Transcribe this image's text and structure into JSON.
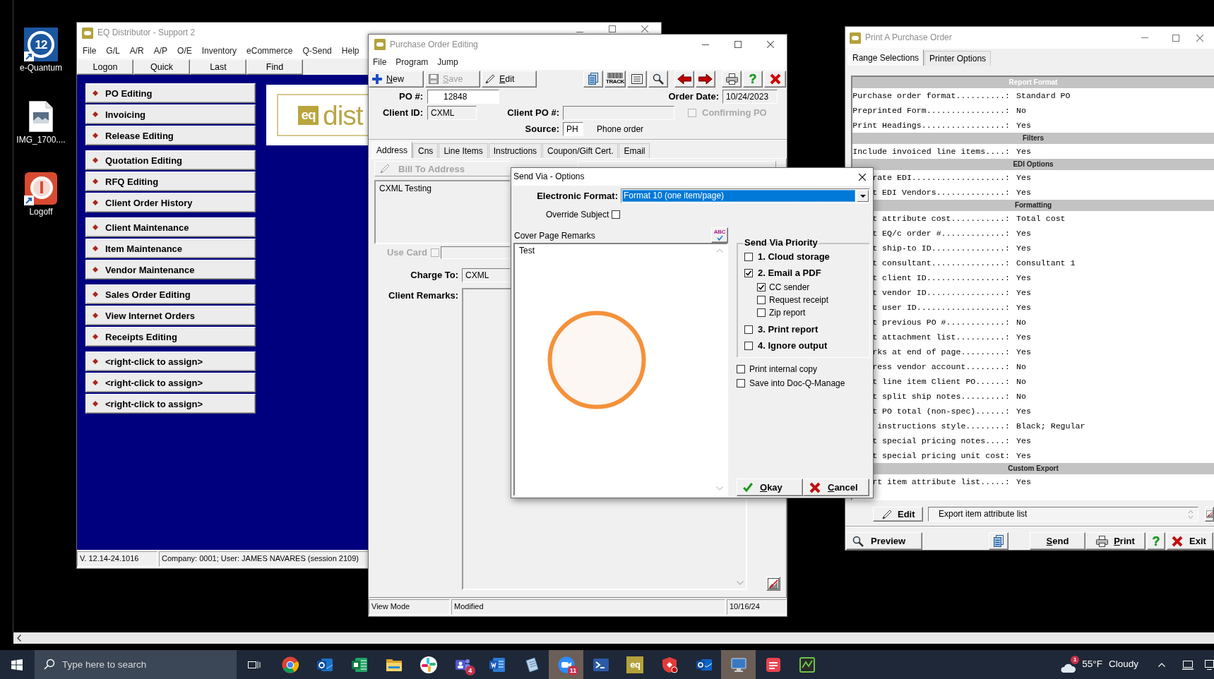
{
  "desktop_icons": [
    {
      "kind": "app",
      "label": "e-Quantum",
      "logo_text": "12"
    },
    {
      "kind": "image",
      "label": "IMG_1700...."
    },
    {
      "kind": "power",
      "label": "Logoff"
    }
  ],
  "eq_window": {
    "title": "EQ Distributor - Support 2",
    "menu": [
      "File",
      "G/L",
      "A/R",
      "A/P",
      "O/E",
      "Inventory",
      "eCommerce",
      "Q-Send",
      "Help"
    ],
    "toolbar": [
      "Logon",
      "Quick",
      "Last",
      "Find"
    ],
    "shortcut_groups": [
      {
        "items": [
          "PO Editing",
          "Invoicing",
          "Release Editing"
        ]
      },
      {
        "items": [
          "Quotation Editing",
          "RFQ Editing",
          "Client Order History"
        ]
      },
      {
        "items": [
          "Client Maintenance",
          "Item Maintenance",
          "Vendor Maintenance"
        ]
      },
      {
        "items": [
          "Sales Order Editing",
          "View Internet Orders",
          "Receipts Editing"
        ]
      },
      {
        "items": [
          "<right-click to assign>",
          "<right-click to assign>",
          "<right-click to assign>"
        ]
      }
    ],
    "logo": {
      "mark": "eq",
      "text": "dist"
    },
    "status_bar": [
      "V. 12.14-24.1016",
      "Company: 0001; User: JAMES NAVARES (session 2109)"
    ]
  },
  "po_window": {
    "title": "Purchase Order Editing",
    "menu": [
      "File",
      "Program",
      "Jump"
    ],
    "toolbar": [
      {
        "kind": "new",
        "label": "New",
        "disabled": false
      },
      {
        "kind": "save",
        "label": "Save",
        "disabled": true
      },
      {
        "kind": "edit",
        "label": "Edit",
        "disabled": false
      }
    ],
    "tool_buttons": [
      {
        "kind": "copy"
      },
      {
        "kind": "track",
        "text": "TRACK"
      },
      {
        "kind": "list"
      },
      {
        "kind": "find"
      },
      {
        "kind": "back"
      },
      {
        "kind": "forward"
      },
      {
        "kind": "print"
      },
      {
        "kind": "help",
        "text": "?"
      },
      {
        "kind": "close"
      }
    ],
    "po_number": {
      "label": "PO #:",
      "value": "12848"
    },
    "order_date": {
      "label": "Order Date:",
      "value": "10/24/2023"
    },
    "client_id": {
      "label": "Client ID:",
      "value": "CXML"
    },
    "client_po": {
      "label": "Client PO #:"
    },
    "confirming_po": {
      "label": "Confirming PO",
      "checked": false,
      "disabled": true
    },
    "source": {
      "label": "Source:",
      "value": "PH",
      "description": "Phone order"
    },
    "tabs": [
      {
        "label": "Address",
        "selected": true
      },
      {
        "label": "Cns",
        "selected": false
      },
      {
        "label": "Line Items",
        "selected": false
      },
      {
        "label": "Instructions",
        "selected": false
      },
      {
        "label": "Coupon/Gift Cert.",
        "selected": false
      },
      {
        "label": "Email",
        "selected": false
      }
    ],
    "bill_to": {
      "title": "Bill To Address",
      "disabled": true,
      "text": "CXML Testing"
    },
    "use_card": {
      "label": "Use Card",
      "checked": false,
      "disabled": true
    },
    "charge_to": {
      "label": "Charge To:",
      "value": "CXML"
    },
    "client_remarks": {
      "label": "Client Remarks:"
    },
    "status_bar": [
      "View Mode",
      "Modified",
      "10/16/24"
    ]
  },
  "send_via_dialog": {
    "title": "Send Via - Options",
    "electronic_format": {
      "label": "Electronic Format:",
      "value": "Format 10 (one item/page)"
    },
    "override_subject": {
      "label": "Override Subject",
      "checked": false
    },
    "cover_page_remarks": {
      "label": "Cover Page Remarks",
      "spell_check": "ABC",
      "value": "Test"
    },
    "priority": {
      "title": "Send Via Priority",
      "options": [
        {
          "label": "1. Cloud storage",
          "checked": false
        },
        {
          "label": "2. Email a PDF",
          "checked": true,
          "children": [
            {
              "label": "CC sender",
              "checked": true
            },
            {
              "label": "Request receipt",
              "checked": false
            },
            {
              "label": "Zip report",
              "checked": false
            }
          ]
        },
        {
          "label": "3. Print report",
          "checked": false
        },
        {
          "label": "4. Ignore output",
          "checked": false
        }
      ]
    },
    "extra_options": [
      {
        "label": "Print internal copy",
        "checked": false
      },
      {
        "label": "Save into Doc-Q-Manage",
        "checked": false
      }
    ],
    "buttons": [
      {
        "kind": "ok",
        "label": "Okay"
      },
      {
        "kind": "cancel",
        "label": "Cancel"
      }
    ]
  },
  "print_window": {
    "title": "Print A Purchase Order",
    "tabs": [
      {
        "label": "Range Selections",
        "selected": true
      },
      {
        "label": "Printer Options",
        "selected": false
      }
    ],
    "sections": [
      {
        "title": "Report Format",
        "highlighted": true,
        "rows": [
          {
            "label": "Purchase order format..........:",
            "value": "Standard PO"
          },
          {
            "label": "Preprinted Form................:",
            "value": "No"
          },
          {
            "label": "Print Headings.................:",
            "value": "Yes"
          }
        ]
      },
      {
        "title": "Filters",
        "highlighted": false,
        "rows": [
          {
            "label": "Include invoiced line items....:",
            "value": "Yes"
          }
        ]
      },
      {
        "title": "EDI Options",
        "highlighted": false,
        "rows": [
          {
            "label": "rate EDI...................:",
            "value": "Yes"
          },
          {
            "label": "t EDI Vendors..............:",
            "value": "Yes"
          }
        ]
      },
      {
        "title": "Formatting",
        "highlighted": false,
        "rows": [
          {
            "label": "t attribute cost...........:",
            "value": "Total cost"
          },
          {
            "label": "t EQ/c order #.............:",
            "value": "Yes"
          },
          {
            "label": "t ship-to ID...............:",
            "value": "Yes"
          },
          {
            "label": "t consultant...............:",
            "value": "Consultant 1"
          },
          {
            "label": "t client ID................:",
            "value": "Yes"
          },
          {
            "label": "t vendor ID................:",
            "value": "Yes"
          },
          {
            "label": "t user ID..................:",
            "value": "Yes"
          },
          {
            "label": "t previous PO #............:",
            "value": "No"
          },
          {
            "label": "t attachment list..........:",
            "value": "Yes"
          },
          {
            "label": "rks at end of page.........:",
            "value": "Yes"
          },
          {
            "label": "ress vendor account........:",
            "value": "No"
          },
          {
            "label": "t line item Client PO......:",
            "value": "No"
          },
          {
            "label": "t split ship notes.........:",
            "value": "No"
          },
          {
            "label": "t PO total (non-spec)......:",
            "value": "Yes"
          },
          {
            "label": "instructions style........:",
            "value": "Black; Regular"
          },
          {
            "label": "t special pricing notes....:",
            "value": "Yes"
          },
          {
            "label": "t special pricing unit cost:",
            "value": "Yes"
          }
        ]
      },
      {
        "title": "Custom Export",
        "highlighted": false,
        "rows": [
          {
            "label": "rt item attribute list.....:",
            "value": "Yes"
          }
        ]
      }
    ],
    "edit_button": "Edit",
    "selected_setting": "Export item attribute list",
    "buttons": [
      {
        "kind": "preview",
        "label": "Preview"
      },
      {
        "kind": "copy"
      },
      {
        "kind": "send",
        "label": "Send"
      },
      {
        "kind": "print",
        "label": "Print"
      },
      {
        "kind": "help",
        "text": "?"
      },
      {
        "kind": "exit",
        "label": "Exit"
      }
    ]
  },
  "taskbar": {
    "search": {
      "placeholder": "Type here to search"
    },
    "apps": [
      {
        "kind": "browser",
        "active": false
      },
      {
        "kind": "mailnew",
        "active": false
      },
      {
        "kind": "sheet",
        "active": false
      },
      {
        "kind": "folder",
        "active": false
      },
      {
        "kind": "pinwheel",
        "active": false
      },
      {
        "kind": "team",
        "active": false,
        "badge": "4"
      },
      {
        "kind": "writer",
        "active": false
      },
      {
        "kind": "notepad",
        "active": false
      },
      {
        "kind": "video",
        "active": true,
        "badge": "11"
      },
      {
        "kind": "terminal",
        "active": false
      },
      {
        "kind": "eq",
        "active": false,
        "text": "eq"
      },
      {
        "kind": "shield",
        "active": false
      },
      {
        "kind": "mail",
        "active": false
      },
      {
        "kind": "remote",
        "active": true
      },
      {
        "kind": "redapp",
        "active": false
      },
      {
        "kind": "greenapp",
        "active": false
      }
    ],
    "weather": {
      "badge": "1",
      "temperature": "55°F",
      "condition": "Cloudy"
    }
  }
}
